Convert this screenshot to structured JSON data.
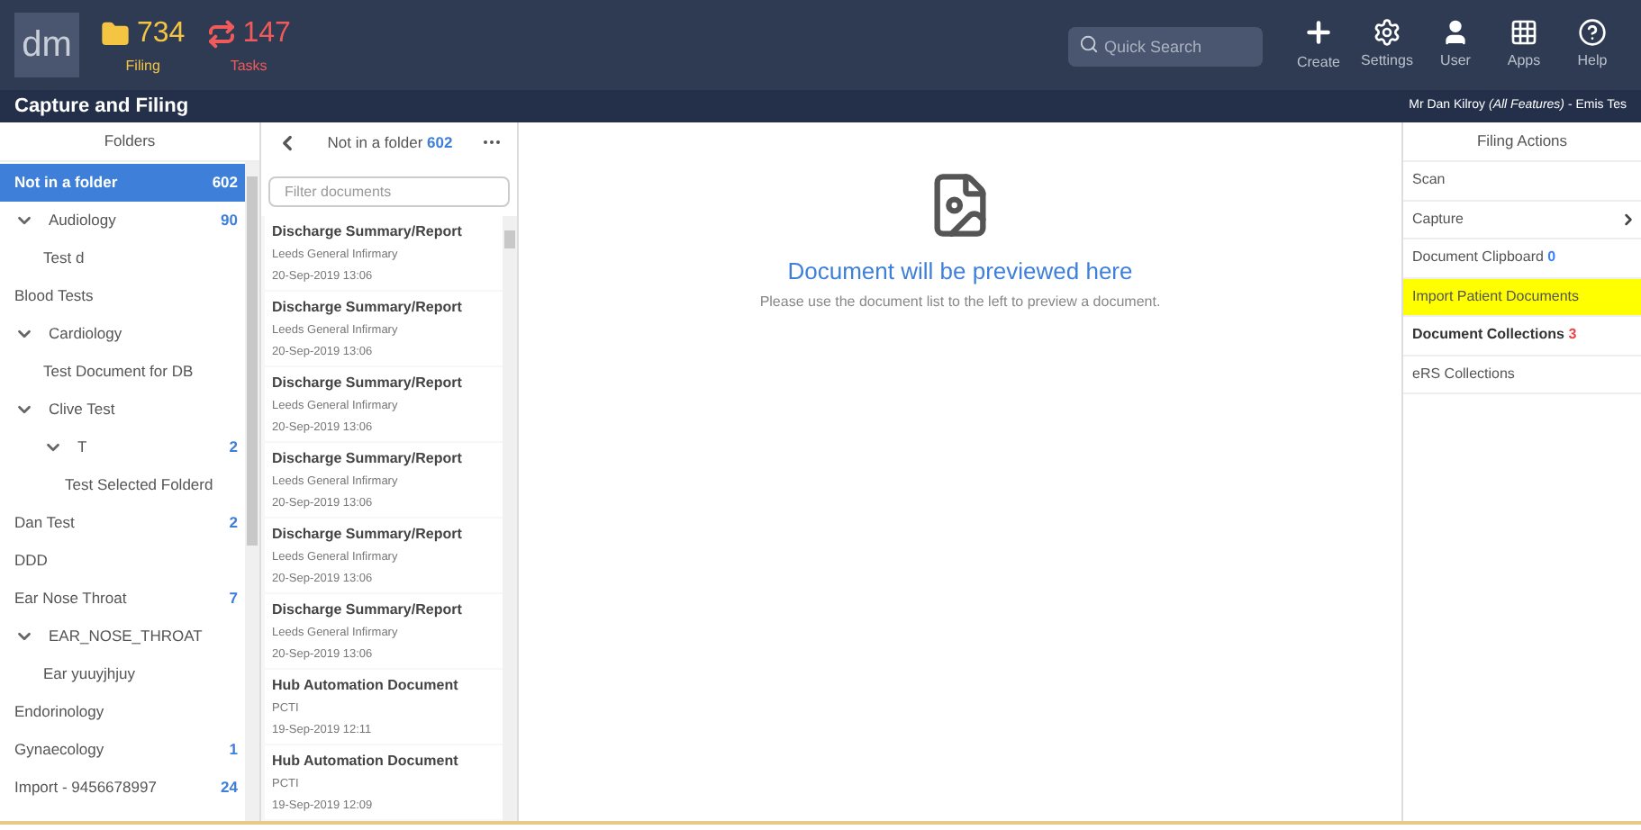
{
  "top_bar": {
    "logo": "dm",
    "counters": [
      {
        "kind": "filing",
        "value": "734",
        "label": "Filing"
      },
      {
        "kind": "tasks",
        "value": "147",
        "label": "Tasks"
      }
    ],
    "search": {
      "placeholder": "Quick Search"
    },
    "actions": [
      {
        "kind": "create",
        "label": "Create"
      },
      {
        "kind": "settings",
        "label": "Settings"
      },
      {
        "kind": "user",
        "label": "User"
      },
      {
        "kind": "apps",
        "label": "Apps"
      },
      {
        "kind": "help",
        "label": "Help"
      }
    ]
  },
  "title_bar": {
    "title": "Capture and Filing",
    "user": "Mr Dan Kilroy",
    "user_role": "(All Features)",
    "user_org": "- Emis Tes"
  },
  "folders": {
    "heading": "Folders",
    "items": [
      {
        "label": "Not in a folder",
        "count": "602",
        "selected": true
      },
      {
        "label": "Audiology",
        "count": "90",
        "selected": false,
        "expanded": true,
        "children": [
          {
            "label": "Test d",
            "selected": false
          }
        ]
      },
      {
        "label": "Blood Tests",
        "selected": false
      },
      {
        "label": "Cardiology",
        "selected": false,
        "expanded": true,
        "children": [
          {
            "label": "Test Document for DB",
            "selected": false
          }
        ]
      },
      {
        "label": "Clive Test",
        "selected": false,
        "expanded": true,
        "children": [
          {
            "label": "T",
            "count": "2",
            "selected": false,
            "expanded": true,
            "children": [
              {
                "label": "Test Selected Folderd",
                "selected": false
              }
            ]
          }
        ]
      },
      {
        "label": "Dan Test",
        "count": "2",
        "selected": false
      },
      {
        "label": "DDD",
        "selected": false
      },
      {
        "label": "Ear Nose Throat",
        "count": "7",
        "selected": false
      },
      {
        "label": "EAR_NOSE_THROAT",
        "selected": false,
        "expanded": true,
        "children": [
          {
            "label": "Ear yuuyjhjuy",
            "selected": false
          }
        ]
      },
      {
        "label": "Endorinology",
        "selected": false
      },
      {
        "label": "Gynaecology",
        "count": "1",
        "selected": false
      },
      {
        "label": "Import - 9456678997",
        "count": "24",
        "selected": false
      }
    ]
  },
  "documents": {
    "heading": "Not in a folder",
    "count": "602",
    "filter_placeholder": "Filter documents",
    "items": [
      {
        "title": "Discharge Summary/Report",
        "source": "Leeds General Infirmary",
        "date": "20-Sep-2019 13:06"
      },
      {
        "title": "Discharge Summary/Report",
        "source": "Leeds General Infirmary",
        "date": "20-Sep-2019 13:06"
      },
      {
        "title": "Discharge Summary/Report",
        "source": "Leeds General Infirmary",
        "date": "20-Sep-2019 13:06"
      },
      {
        "title": "Discharge Summary/Report",
        "source": "Leeds General Infirmary",
        "date": "20-Sep-2019 13:06"
      },
      {
        "title": "Discharge Summary/Report",
        "source": "Leeds General Infirmary",
        "date": "20-Sep-2019 13:06"
      },
      {
        "title": "Discharge Summary/Report",
        "source": "Leeds General Infirmary",
        "date": "20-Sep-2019 13:06"
      },
      {
        "title": "Hub Automation Document",
        "source": "PCTI",
        "date": "19-Sep-2019 12:11"
      },
      {
        "title": "Hub Automation Document",
        "source": "PCTI",
        "date": "19-Sep-2019 12:09"
      }
    ]
  },
  "preview": {
    "heading": "Document will be previewed here",
    "hint": "Please use the document list to the left to preview a document."
  },
  "filing_actions": {
    "heading": "Filing Actions",
    "items": [
      {
        "label": "Scan",
        "bold": false,
        "highlighted": false
      },
      {
        "label": "Capture",
        "bold": false,
        "highlighted": false,
        "has_submenu": true
      },
      {
        "label": "Document Clipboard",
        "count": "0",
        "color": "#3b82f6",
        "bold": false,
        "highlighted": false
      },
      {
        "label": "Import Patient Documents",
        "bold": false,
        "highlighted": true
      },
      {
        "label": "Document Collections",
        "count": "3",
        "color": "#ef4444",
        "bold": true,
        "highlighted": false
      },
      {
        "label": "eRS Collections",
        "bold": false,
        "highlighted": false
      }
    ]
  }
}
